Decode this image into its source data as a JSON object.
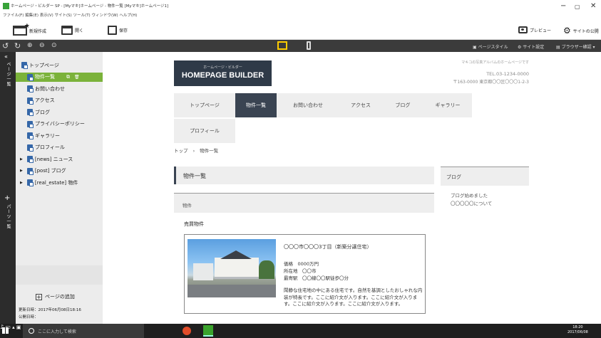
{
  "app": {
    "title": "ホームページ・ビルダー SP - [Myマキ]ホームページ - 物件一覧 [Myマキ]ホームページ1]",
    "menu": "ファイル(F)  編集(E)  表示(V)  サイト(S)  ツール(T)  ウィンドウ(W)  ヘルプ(H)",
    "win_min": "−",
    "win_max": "▢",
    "win_close": "✕"
  },
  "toolbar": {
    "new_label": "新規作成",
    "open_label": "開く",
    "save_label": "保存",
    "preview_label": "プレビュー",
    "site_publish_label": "サイトの公開"
  },
  "darkbar": {
    "page_style": "ページスタイル",
    "site_settings": "サイト設定",
    "browser_check": "ブラウザー確認"
  },
  "sidebar": {
    "strip_top": "ページ一覧",
    "strip_bottom": "パーツ一覧",
    "tree": [
      {
        "label": "トップページ",
        "indent": 0
      },
      {
        "label": "物件一覧",
        "indent": 1,
        "selected": true
      },
      {
        "label": "お問い合わせ",
        "indent": 1
      },
      {
        "label": "アクセス",
        "indent": 1
      },
      {
        "label": "ブログ",
        "indent": 1
      },
      {
        "label": "プライバシーポリシー",
        "indent": 1
      },
      {
        "label": "ギャラリー",
        "indent": 1
      },
      {
        "label": "プロフィール",
        "indent": 1
      },
      {
        "label": "[news] ニュース",
        "indent": 0,
        "expand": true
      },
      {
        "label": "[post] ブログ",
        "indent": 0,
        "expand": true
      },
      {
        "label": "[real_estate] 物件",
        "indent": 0,
        "expand": true
      }
    ],
    "add_page": "ページの追加",
    "updated": "更新日時：2017年06月08日18:16",
    "published": "公開日時："
  },
  "site": {
    "logo_small": "ホームページ・ビルダー",
    "logo_big": "HOMEPAGE BUILDER",
    "tagline": "マキコの写真アルバムのホームページです",
    "tel": "TEL.03-1234-0000",
    "address": "〒163-0000 東京都〇〇区〇〇〇1-2-3",
    "nav": [
      "トップページ",
      "物件一覧",
      "お問い合わせ",
      "アクセス",
      "ブログ",
      "ギャラリー"
    ],
    "nav2": "プロフィール",
    "breadcrumb_home": "トップ",
    "breadcrumb_sep": "›",
    "breadcrumb_current": "物件一覧",
    "heading": "物件一覧",
    "subheading": "物件",
    "section_label": "売買物件",
    "property": {
      "title": "〇〇〇市〇〇〇3丁目（新築分譲住宅）",
      "price": "価格　0000万円",
      "location": "所在地　〇〇市",
      "station": "最寄駅　〇〇線〇〇駅徒歩〇分",
      "desc": "閑静な住宅地の中にある住宅です。自然を基調としたおしゃれな内装が特長です。ここに紹介文が入ります。ここに紹介文が入ります。ここに紹介文が入ります。ここに紹介文が入ります。"
    },
    "blog_title": "ブログ",
    "blog_items": [
      "ブログ始めました",
      "〇〇〇〇〇について"
    ]
  },
  "taskbar": {
    "search": "ここに入力して検索",
    "time": "18:20",
    "date": "2017/06/08"
  }
}
